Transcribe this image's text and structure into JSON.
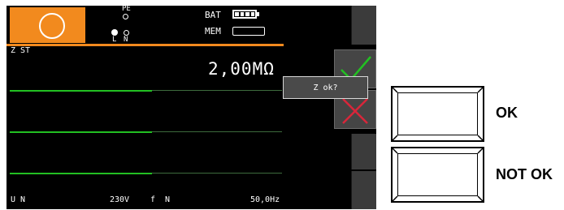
{
  "header": {
    "terminal_pe": "PE",
    "terminal_l": "L",
    "terminal_n": "N",
    "battery_label": "BAT",
    "memory_label": "MEM"
  },
  "measurement": {
    "mode": "Z ST",
    "reading": "2,00",
    "reading_unit": "MΩ"
  },
  "dialog": {
    "question": "Z ok?"
  },
  "footer": {
    "voltage_label": "U N",
    "voltage_value": "230V",
    "frequency_label": "f  N",
    "frequency_value": "50,0Hz"
  },
  "legend": {
    "ok_label": "OK",
    "not_ok_label": "NOT OK"
  },
  "colors": {
    "accent": "#f28a1e",
    "ok_green": "#22c022",
    "error_red": "#d8263a",
    "screen_bg": "#000000"
  },
  "icons": {
    "ok": "check-icon",
    "not_ok": "cross-icon",
    "mode": "circle-icon"
  }
}
